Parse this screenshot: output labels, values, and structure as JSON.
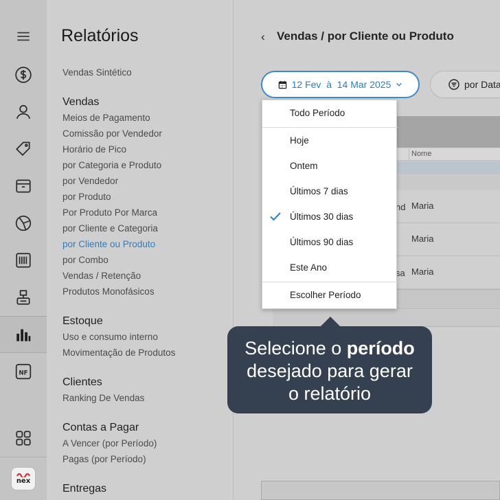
{
  "sidebar": {
    "icons": [
      "hamburger-menu-icon",
      "dollar-circle-icon",
      "user-icon",
      "tag-icon",
      "box-icon",
      "pie-chart-icon",
      "barcode-icon",
      "register-icon",
      "bar-chart-icon",
      "nf-icon",
      "grid-apps-icon"
    ],
    "active": "bar-chart-icon",
    "nf_label": "NF",
    "logo_text": "nex"
  },
  "menu": {
    "title": "Relatórios",
    "top_link": "Vendas Sintético",
    "sections": [
      {
        "heading": "Vendas",
        "items": [
          "Meios de Pagamento",
          "Comissão por Vendedor",
          "Horário de Pico",
          "por Categoria e Produto",
          "por Vendedor",
          "por Produto",
          "Por Produto Por Marca",
          "por Cliente e Categoria",
          "por Cliente ou Produto",
          "por Combo",
          "Vendas / Retenção",
          "Produtos Monofásicos"
        ]
      },
      {
        "heading": "Estoque",
        "items": [
          "Uso e consumo interno",
          "Movimentação de Produtos"
        ]
      },
      {
        "heading": "Clientes",
        "items": [
          "Ranking De Vendas"
        ]
      },
      {
        "heading": "Contas a Pagar",
        "items": [
          "A Vencer (por Período)",
          "Pagas (por Período)"
        ]
      },
      {
        "heading": "Entregas",
        "items": []
      }
    ],
    "active_item": "por Cliente ou Produto"
  },
  "header": {
    "back_symbol": "‹",
    "title": "Vendas / por Cliente ou Produto"
  },
  "filters": {
    "date_range": "12 Fev  à  14 Mar 2025",
    "group_by": "por Data"
  },
  "table": {
    "column_header": "Nome",
    "rows": [
      {
        "fragment": "nd",
        "name": "Maria"
      },
      {
        "fragment": "",
        "name": "Maria"
      },
      {
        "fragment": "sa",
        "name": "Maria"
      }
    ]
  },
  "dropdown": {
    "items": [
      "Todo Período",
      "Hoje",
      "Ontem",
      "Últimos 7 dias",
      "Últimos 30 dias",
      "Últimos 90 dias",
      "Este Ano",
      "Escolher Período"
    ],
    "selected": "Últimos 30 dias"
  },
  "tooltip": {
    "line1_prefix": "Selecione o ",
    "line1_bold": "período",
    "line2": "desejado para gerar",
    "line3": "o relatório"
  },
  "colors": {
    "accent": "#2a7fc4",
    "tooltip_bg": "#354151",
    "overlay_gray": "#cfcfcf"
  }
}
